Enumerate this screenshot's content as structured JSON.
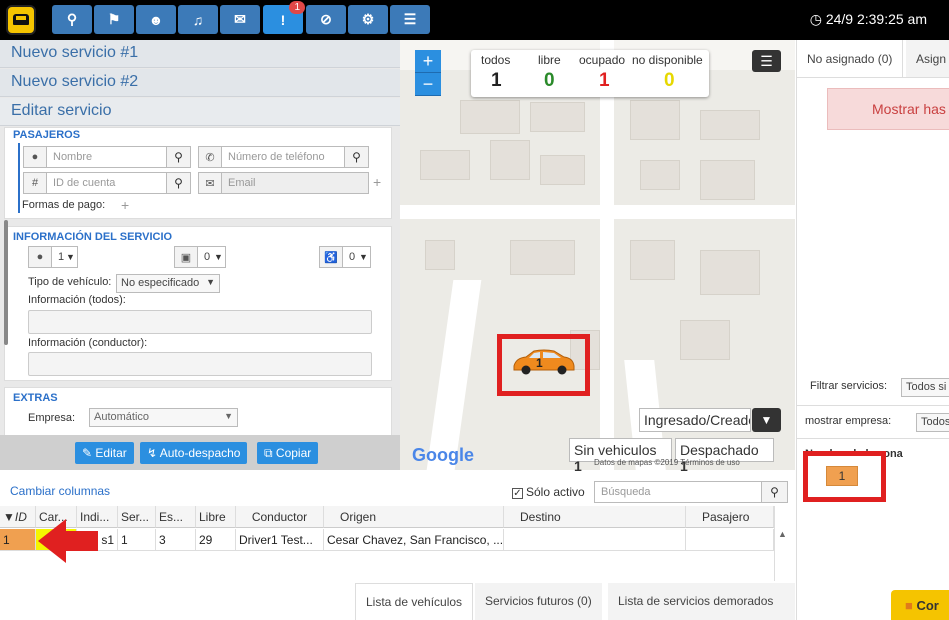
{
  "topbar": {
    "clock": "24/9 2:39:25 am",
    "alert_badge": "1",
    "icons": [
      "search-icon",
      "flag-icon",
      "users-icon",
      "bell-icon",
      "chat-icon",
      "alert-icon",
      "ban-icon",
      "gear-icon",
      "list-icon"
    ]
  },
  "accordion": {
    "new1": "Nuevo servicio #1",
    "new2": "Nuevo servicio #2",
    "edit": "Editar servicio"
  },
  "pasajeros": {
    "title": "PASAJEROS",
    "name_placeholder": "Nombre",
    "phone_placeholder": "Número de teléfono",
    "account_placeholder": "ID de cuenta",
    "email_placeholder": "Email",
    "payment_label": "Formas de pago:"
  },
  "info": {
    "title": "INFORMACIÓN DEL SERVICIO",
    "passengers": "1",
    "luggage": "0",
    "wheelchair": "0",
    "vehicle_type_label": "Tipo de vehículo:",
    "vehicle_type_value": "No especificado",
    "info_all_label": "Información (todos):",
    "info_driver_label": "Información (conductor):"
  },
  "extras": {
    "title": "EXTRAS",
    "company_label": "Empresa:",
    "company_value": "Automático"
  },
  "actions": {
    "edit": "Editar",
    "auto": "Auto-despacho",
    "copy": "Copiar"
  },
  "map": {
    "counters": [
      {
        "label": "todos",
        "value": "1",
        "color": "#222222"
      },
      {
        "label": "libre",
        "value": "0",
        "color": "#2a8a2a"
      },
      {
        "label": "ocupado",
        "value": "1",
        "color": "#e02020"
      },
      {
        "label": "no disponible",
        "value": "0",
        "color": "#e6d800"
      }
    ],
    "marker_label": "1",
    "ingresado": "Ingresado/Creado",
    "sin_vehiculos_label": "Sin vehiculos",
    "sin_vehiculos_count": "1",
    "despachado_label": "Despachado",
    "despachado_count": "1",
    "google": "Google",
    "mapdata": "Datos de mapas ©2019   Términos de uso"
  },
  "table": {
    "cambiar": "Cambiar columnas",
    "solo_activo": "Sólo activo",
    "search_placeholder": "Búsqueda",
    "columns": [
      "ID",
      "Car...",
      "Indi...",
      "Ser...",
      "Es...",
      "Libre",
      "Conductor",
      "Origen",
      "Destino",
      "Pasajero"
    ],
    "rows": [
      [
        "1",
        "",
        "s1",
        "1",
        "3",
        "29",
        "Driver1 Test...",
        "Cesar Chavez, San Francisco, ...",
        "",
        ""
      ]
    ]
  },
  "bottom_tabs": [
    "Lista de vehículos",
    "Servicios futuros (0)",
    "Lista de servicios demorados"
  ],
  "right": {
    "tab1": "No asignado (0)",
    "tab2": "Asign",
    "mostrar": "Mostrar has",
    "filter_label": "Filtrar servicios:",
    "filter_value": "Todos si",
    "company_label": "mostrar empresa:",
    "company_value": "Todos",
    "header": "Nombre de la zona",
    "zone_badge": "1",
    "chat": "Cor"
  }
}
